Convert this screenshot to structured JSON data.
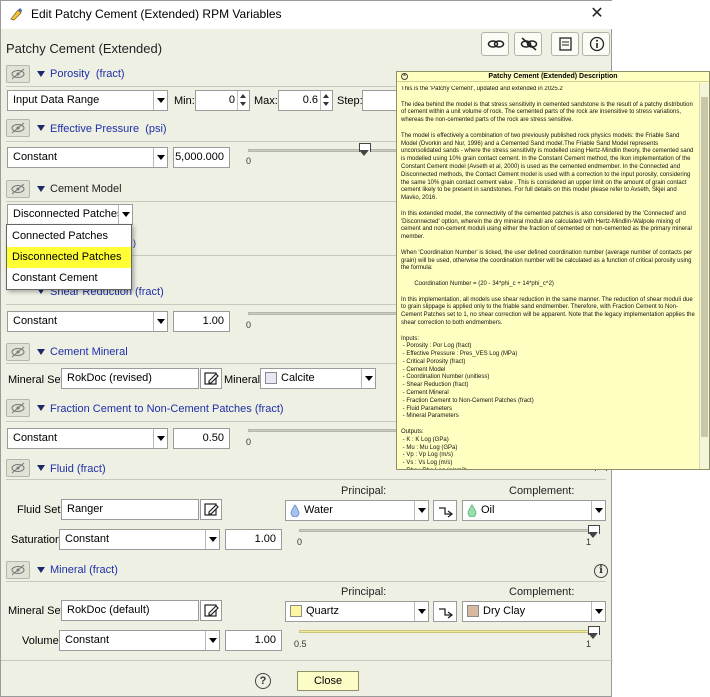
{
  "window": {
    "title": "Edit Patchy Cement (Extended) RPM Variables",
    "close_glyph": "✕"
  },
  "model_title": "Patchy Cement (Extended)",
  "toolbar_icons": [
    "link-icon",
    "unlink-icon",
    "edit-description-icon",
    "info-icon"
  ],
  "sections": {
    "porosity": {
      "title": "Porosity",
      "unit": "(fract)",
      "source": "Input Data Range",
      "min_label": "Min:",
      "min_value": "0",
      "max_label": "Max:",
      "max_value": "0.6",
      "step_label": "Step:"
    },
    "pressure": {
      "title": "Effective Pressure",
      "unit": "(psi)",
      "source": "Constant",
      "value": "5,000.000",
      "tick_min": "0"
    },
    "cement_model": {
      "title": "Cement Model",
      "selected": "Disconnected Patches",
      "options": [
        "Connected Patches",
        "Disconnected Patches",
        "Constant Cement"
      ],
      "highlighted_index": 1
    },
    "shear": {
      "title": "Shear Reduction",
      "unit": "(fract)",
      "source": "Constant",
      "value": "1.00",
      "tick_min": "0"
    },
    "cement_mineral": {
      "title": "Cement Mineral",
      "set_label": "Mineral Set:",
      "set_value": "RokDoc (revised)",
      "mineral_label": "Mineral:",
      "mineral_value": "Calcite",
      "mineral_color": "#e8e8f4"
    },
    "fraction": {
      "title": "Fraction Cement to Non-Cement Patches",
      "unit": "(fract)",
      "source": "Constant",
      "value": "0.50",
      "tick_min": "0"
    },
    "fluid": {
      "title": "Fluid",
      "unit": "(fract)",
      "principal_label": "Principal:",
      "complement_label": "Complement:",
      "set_label": "Fluid Set:",
      "set_value": "Ranger",
      "principal_value": "Water",
      "complement_value": "Oil",
      "saturation_label": "Saturation:",
      "saturation_source": "Constant",
      "saturation_value": "1.00",
      "tick_min": "0",
      "tick_max": "1",
      "water_color": "#a8c0f0",
      "oil_color": "#98e0b0"
    },
    "mineral": {
      "title": "Mineral",
      "unit": "(fract)",
      "principal_label": "Principal:",
      "complement_label": "Complement:",
      "set_label": "Mineral Set:",
      "set_value": "RokDoc (default)",
      "principal_value": "Quartz",
      "complement_value": "Dry Clay",
      "volume_label": "Volume:",
      "volume_source": "Constant",
      "volume_value": "1.00",
      "tick_min": "0.5",
      "tick_max": "1",
      "quartz_color": "#fff7a0",
      "clay_color": "#d8b8a0"
    }
  },
  "description": {
    "title": "Patchy Cement (Extended) Description",
    "body": "This is the 'Patchy Cement', updated and extended in 2025.2\n\nThe idea behind the model is that stress sensitivity in cemented sandstone is the result of a patchy distribution of cement within a unit volume of rock. The cemented parts of the rock are insensitive to stress variations, whereas the non-cemented parts of the rock are stress sensitive.\n\nThe model is effectively a combination of two previously published rock physics models: the Friable Sand Model (Dvorkin and Nur, 1996) and a Cemented Sand model.The Friable Sand Model represents unconsolidated sands - where the stress sensitivity is modelled using Hertz-Mindlin theory, the cemented sand is modelled using 10% grain contact cement. In the Constant Cement method, the Ikon implementation of the Constant Cement model (Avseth et al, 2000) is used as the cemented endmember. In the Connected and Disconnected methods, the Contact Cement model is used with a correction to the input porosity, considering the same 10% grain contact cement value . This is considered an upper limit on the amount of grain contact cement likely to be present in sandstones. For full details on this model please refer to Avseth, Skjei and Mavko, 2016.\n\nIn this extended model, the connectivity of the cemented patches is also considered by the 'Connected' and 'Disconnected' option, wherein the dry mineral moduli are calculated with Hertz-Mindlin-Walpole mixing of cement and non-cement moduli using either the fraction of cemented or non-cemented as the primary mineral member.\n\nWhen 'Coordination Number' is ticked, the user defined coordination number (average number of contacts per grain) will be used, otherwise the coordination number will be calculated as a function of critical porosity using the formula:\n\n        Coordination Number = (20 - 34*phi_c + 14*phi_c^2)\n\nIn this implementation, all models use shear reduction in the same manner. The reduction of shear moduli due to grain slippage is applied only to the friable sand endmember. Therefore, with Fraction Cement to Non-Cement Patches set to 1, no shear correction will be apparent. Note that the legacy implementation applies the shear correction to both endmembers.\n\nInputs:\n - Porosity : Por Log (fract)\n - Effective Pressure : Pres_VES Log (MPa)\n - Critical Porosity (fract)\n - Cement Model\n - Coordination Number (unitless)\n - Shear Reduction (fract)\n - Cement Mineral\n - Fraction Cement to Non-Cement Patches (fract)\n - Fluid Parameters\n - Mineral Parameters\n\nOutputs:\n - K : K Log (GPa)\n - Mu : Mu Log (GPa)\n - Vp : Vp Log (m/s)\n - Vs : Vs Log (m/s)\n - Rho : Rho Log (g/cm3)\n\nDerivable Outputs:"
  },
  "footer": {
    "help_glyph": "?",
    "close_label": "Close"
  }
}
